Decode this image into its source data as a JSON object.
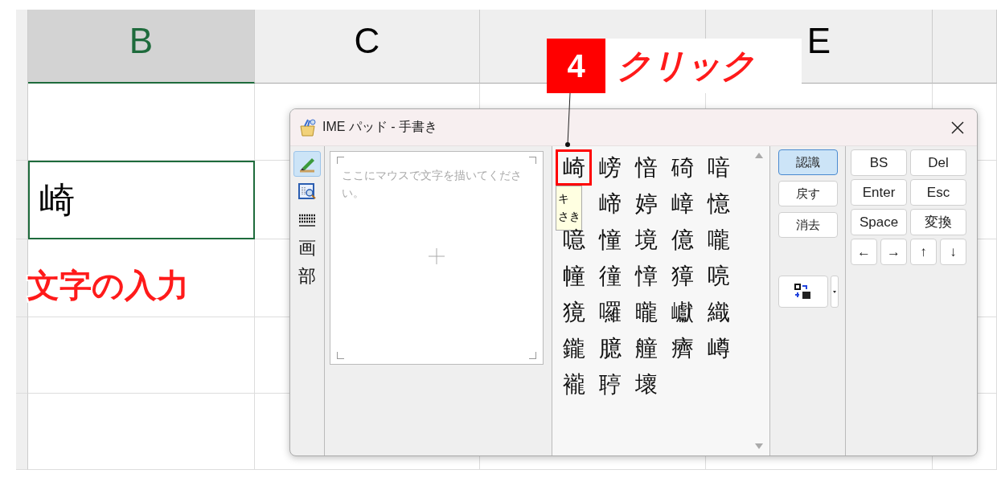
{
  "sheet": {
    "columns": [
      {
        "label": "B",
        "selected": true
      },
      {
        "label": "C",
        "selected": false
      },
      {
        "selected": false
      },
      {
        "label": "E",
        "selected": false
      }
    ],
    "selected_cell": {
      "value": "崎"
    },
    "annotation": "文字の入力"
  },
  "callout": {
    "step": "4",
    "text": "クリック"
  },
  "window": {
    "title": "IME パッド - 手書き",
    "tools": [
      {
        "kind": "pen",
        "selected": true
      },
      {
        "kind": "list",
        "selected": false
      },
      {
        "kind": "keyboard",
        "selected": false
      },
      {
        "kind": "char",
        "label": "画",
        "selected": false
      },
      {
        "kind": "char",
        "label": "部",
        "selected": false
      }
    ],
    "drawing_area": {
      "placeholder": "ここにマウスで文字を描いてください。"
    },
    "candidates": [
      {
        "kind": "char",
        "text": "崎",
        "selected": true
      },
      {
        "kind": "char",
        "text": "嵭",
        "selected": false
      },
      {
        "kind": "char",
        "text": "愔",
        "selected": false
      },
      {
        "kind": "char",
        "text": "碕",
        "selected": false
      },
      {
        "kind": "char",
        "text": "喑",
        "selected": false
      },
      {
        "kind": "tooltip",
        "lines": [
          "キ",
          "さき"
        ]
      },
      {
        "kind": "char",
        "text": "崹",
        "selected": false
      },
      {
        "kind": "char",
        "text": "婷",
        "selected": false
      },
      {
        "kind": "char",
        "text": "嶂",
        "selected": false
      },
      {
        "kind": "char",
        "text": "憶",
        "selected": false
      },
      {
        "kind": "char",
        "text": "噫",
        "selected": false
      },
      {
        "kind": "char",
        "text": "憧",
        "selected": false
      },
      {
        "kind": "char",
        "text": "境",
        "selected": false
      },
      {
        "kind": "char",
        "text": "億",
        "selected": false
      },
      {
        "kind": "char",
        "text": "嚨",
        "selected": false
      },
      {
        "kind": "char",
        "text": "幢",
        "selected": false
      },
      {
        "kind": "char",
        "text": "徸",
        "selected": false
      },
      {
        "kind": "char",
        "text": "慞",
        "selected": false
      },
      {
        "kind": "char",
        "text": "獐",
        "selected": false
      },
      {
        "kind": "char",
        "text": "喨",
        "selected": false
      },
      {
        "kind": "char",
        "text": "獍",
        "selected": false
      },
      {
        "kind": "char",
        "text": "囉",
        "selected": false
      },
      {
        "kind": "char",
        "text": "曨",
        "selected": false
      },
      {
        "kind": "char",
        "text": "巘",
        "selected": false
      },
      {
        "kind": "char",
        "text": "織",
        "selected": false
      },
      {
        "kind": "char",
        "text": "鑨",
        "selected": false
      },
      {
        "kind": "char",
        "text": "臆",
        "selected": false
      },
      {
        "kind": "char",
        "text": "艟",
        "selected": false
      },
      {
        "kind": "char",
        "text": "癠",
        "selected": false
      },
      {
        "kind": "char",
        "text": "嶟",
        "selected": false
      },
      {
        "kind": "char",
        "text": "襱",
        "selected": false
      },
      {
        "kind": "char",
        "text": "聤",
        "selected": false
      },
      {
        "kind": "char",
        "text": "壞",
        "selected": false
      }
    ],
    "actions": [
      {
        "label": "認識",
        "selected": true
      },
      {
        "label": "戻す",
        "selected": false
      },
      {
        "label": "消去",
        "selected": false
      }
    ],
    "keys": [
      {
        "label": "BS",
        "kind": "wide"
      },
      {
        "label": "Del",
        "kind": "wide"
      },
      {
        "label": "Enter",
        "kind": "wide"
      },
      {
        "label": "Esc",
        "kind": "wide"
      },
      {
        "label": "Space",
        "kind": "wide"
      },
      {
        "label": "変換",
        "kind": "wide"
      },
      {
        "label": "←",
        "kind": "narrow"
      },
      {
        "label": "→",
        "kind": "narrow"
      },
      {
        "label": "↑",
        "kind": "narrow"
      },
      {
        "label": "↓",
        "kind": "narrow"
      }
    ]
  }
}
